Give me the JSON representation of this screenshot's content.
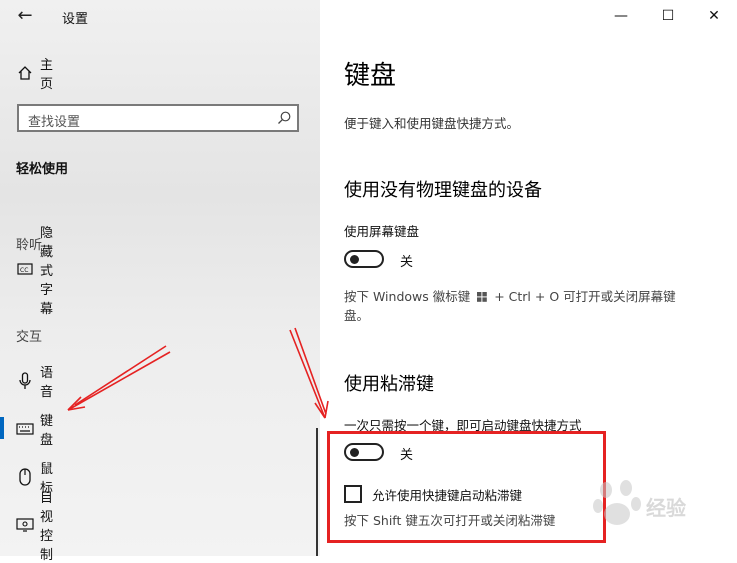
{
  "window": {
    "title": "设置",
    "minimize": "—",
    "maximize": "☐",
    "close": "✕"
  },
  "sidebar": {
    "home_label": "主页",
    "search_placeholder": "查找设置",
    "category": "轻松使用",
    "groups": {
      "hearing": "聆听",
      "interaction": "交互"
    },
    "items": [
      {
        "label": "隐藏式字幕",
        "icon": "closed-caption-icon"
      },
      {
        "label": "语音",
        "icon": "microphone-icon"
      },
      {
        "label": "键盘",
        "icon": "keyboard-icon",
        "selected": true
      },
      {
        "label": "鼠标",
        "icon": "mouse-icon"
      },
      {
        "label": "目视控制",
        "icon": "eye-control-icon"
      }
    ]
  },
  "main": {
    "page_title": "键盘",
    "page_desc": "便于键入和使用键盘快捷方式。",
    "section1": {
      "heading": "使用没有物理键盘的设备",
      "label": "使用屏幕键盘",
      "toggle_state": "关",
      "note_part1": "按下 Windows 徽标键",
      "note_part2": "+ Ctrl + O 可打开或关闭屏幕键",
      "note_line2": "盘。"
    },
    "section2": {
      "heading": "使用粘滞键",
      "label": "一次只需按一个键，即可启动键盘快捷方式",
      "toggle_state": "关",
      "checkbox_label": "允许使用快捷键启动粘滞键",
      "note": "按下 Shift 键五次可打开或关闭粘滞键"
    }
  },
  "watermark": {
    "text": "经验"
  },
  "colors": {
    "accent": "#0067c0",
    "highlight": "#e52222"
  }
}
